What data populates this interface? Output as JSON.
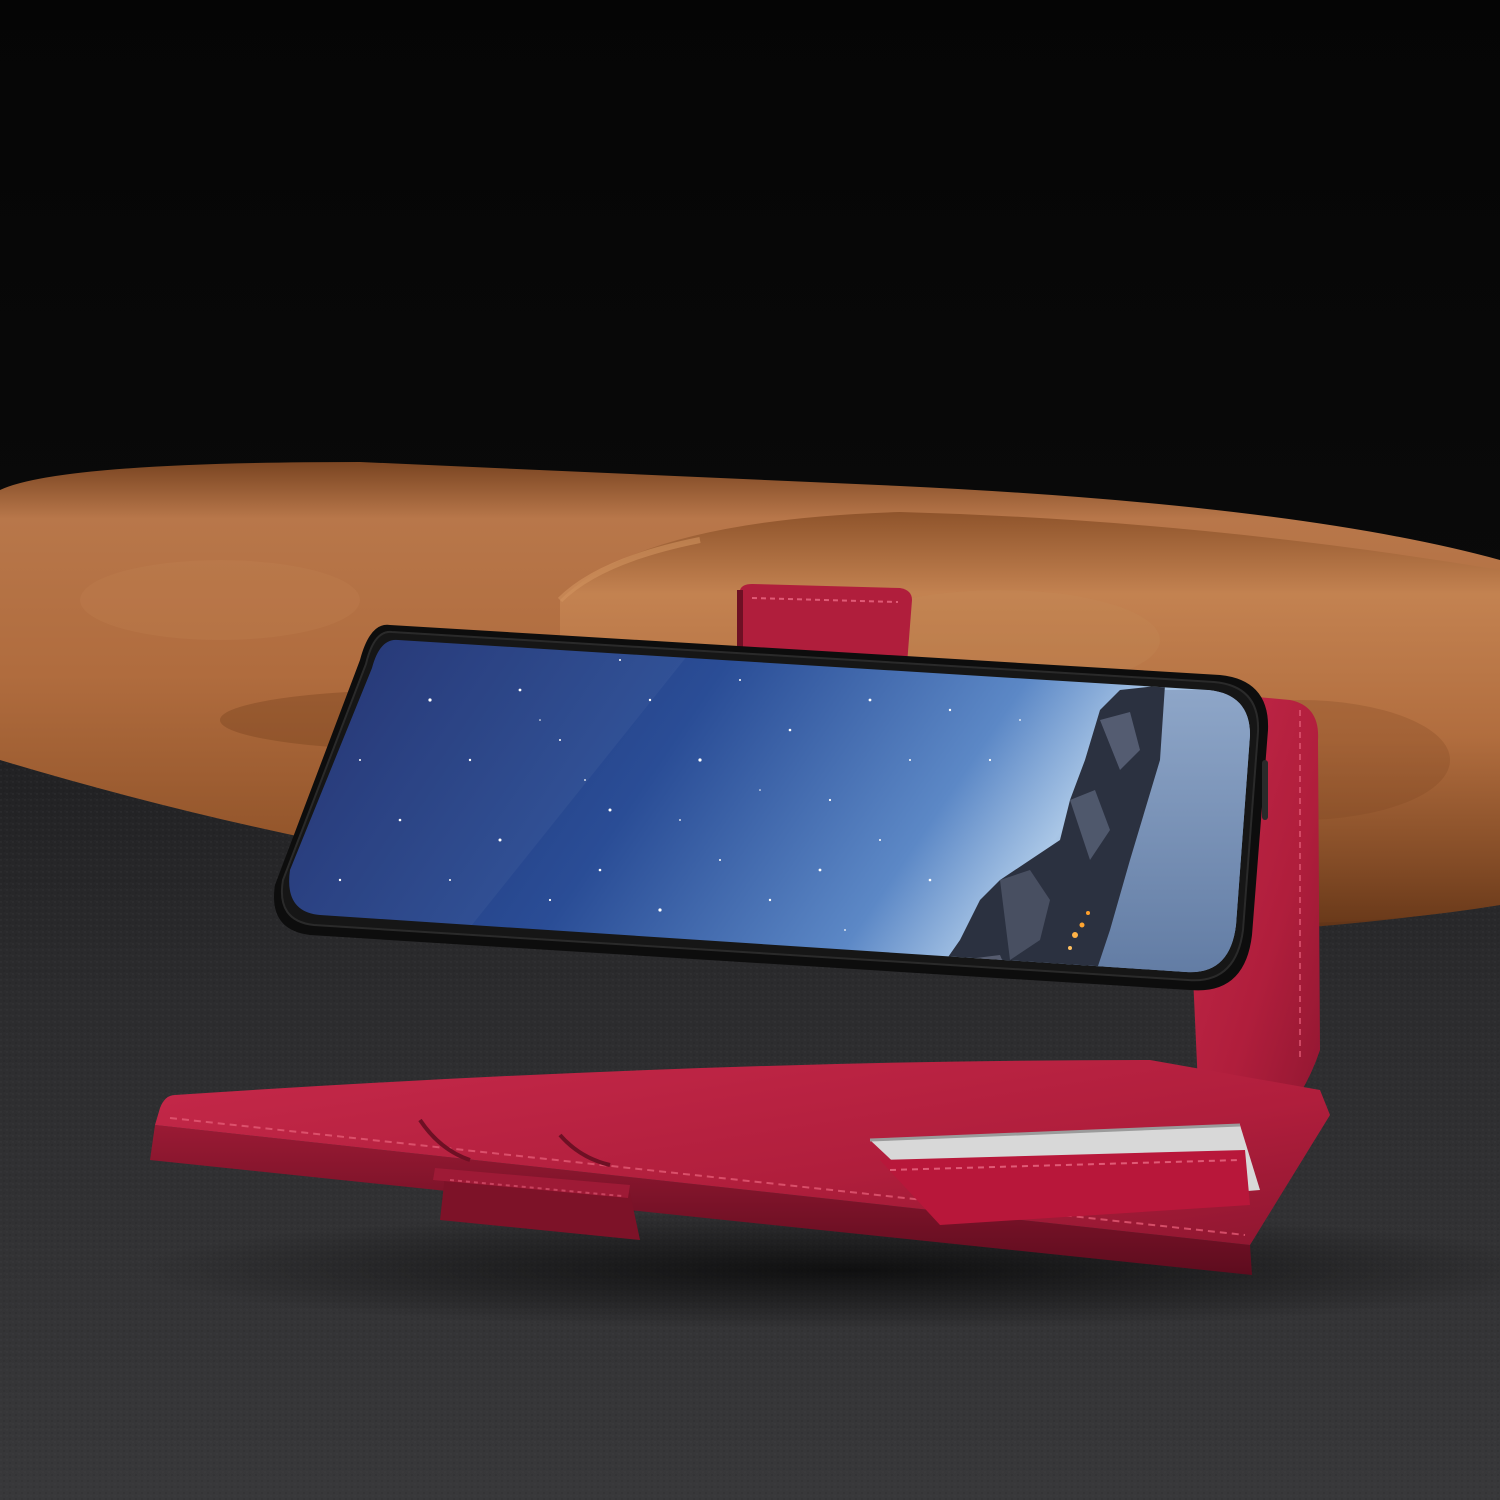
{
  "scene": {
    "subject": "red-leather-wallet-phone-case",
    "colors": {
      "backdrop": "#070707",
      "table_surface": "#2a2a2c",
      "suede_roll": "#a8683a",
      "case_red": "#b21f3e",
      "case_shadow": "#6e1024",
      "bezel": "#111111",
      "screen_sky_top": "#1e3070",
      "screen_sky_bottom": "#8fb4de",
      "mountain": "#2c3242"
    }
  }
}
